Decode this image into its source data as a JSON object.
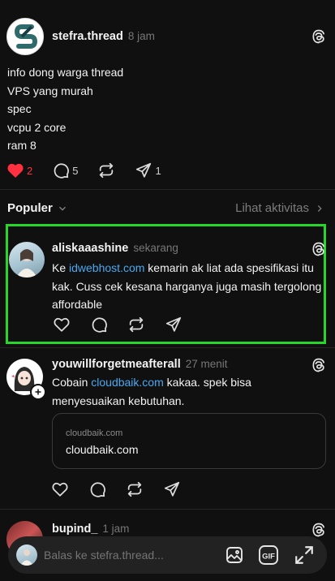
{
  "main_post": {
    "username": "stefra.thread",
    "time": "8 jam",
    "lines": [
      "info dong warga thread",
      "VPS yang murah",
      "spec",
      "vcpu 2 core",
      "ram 8"
    ],
    "like_count": "2",
    "reply_count": "5",
    "share_count": "1"
  },
  "section": {
    "title": "Populer",
    "activity_link": "Lihat aktivitas"
  },
  "replies": [
    {
      "username": "aliskaaashine",
      "time": "sekarang",
      "text_before": "Ke ",
      "link": "idwebhost.com",
      "text_after": " kemarin ak liat ada spesifikasi itu kak. Cuss cek kesana harganya juga masih tergolong affordable"
    },
    {
      "username": "youwillforgetmeafterall",
      "time": "27 menit",
      "text_before": "Cobain ",
      "link": "cloudbaik.com",
      "text_after": " kakaa. spek bisa menyesuaikan kebutuhan.",
      "preview_domain": "cloudbaik.com",
      "preview_title": "cloudbaik.com"
    },
    {
      "username": "bupind_",
      "time": "1 jam"
    }
  ],
  "composer": {
    "placeholder": "Balas ke stefra.thread..."
  },
  "colors": {
    "background": "#101010",
    "like_red": "#ff3040",
    "link_blue": "#4aa8f0",
    "highlight_green": "#27d62b"
  }
}
